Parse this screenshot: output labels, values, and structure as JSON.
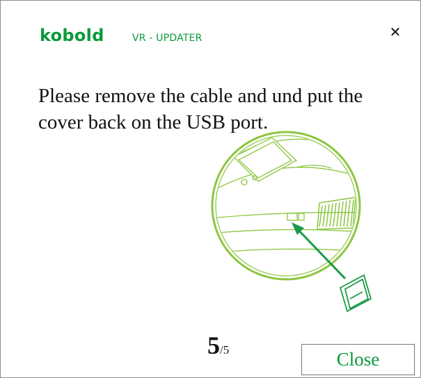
{
  "header": {
    "brand": "kobold",
    "product": "VR - UPDATER",
    "close_icon": "close-icon"
  },
  "instruction": "Please remove the cable and und put the cover back on the USB port.",
  "illustration": {
    "icon": "robot-usb-port-cover-icon"
  },
  "pager": {
    "current": "5",
    "separator": "/",
    "total": "5"
  },
  "footer": {
    "close_label": "Close"
  },
  "colors": {
    "brand_green": "#0b9a3a",
    "illustration_green": "#8cc63f",
    "arrow_green": "#1a9a4a"
  }
}
